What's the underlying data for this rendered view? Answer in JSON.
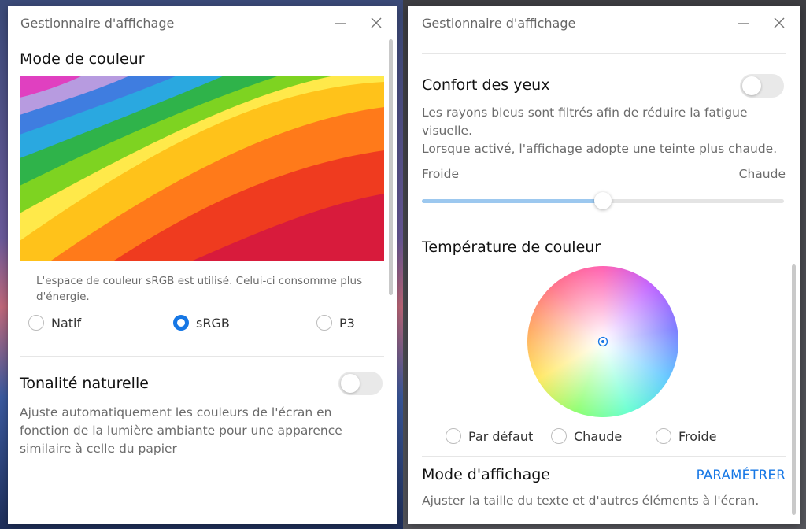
{
  "left_window": {
    "title": "Gestionnaire d'affichage",
    "color_mode": {
      "title": "Mode de couleur",
      "description": "L'espace de couleur sRGB est utilisé. Celui-ci consomme plus d'énergie.",
      "options": [
        "Natif",
        "sRGB",
        "P3"
      ],
      "selected": "sRGB"
    },
    "natural_tone": {
      "title": "Tonalité naturelle",
      "enabled": false,
      "description": "Ajuste automatiquement les couleurs de l'écran en fonction de la lumière ambiante pour une apparence similaire à celle du papier"
    }
  },
  "right_window": {
    "title": "Gestionnaire d'affichage",
    "eye_comfort": {
      "title": "Confort des yeux",
      "enabled": false,
      "description1": "Les rayons bleus sont filtrés afin de réduire la fatigue visuelle.",
      "description2": "Lorsque activé, l'affichage adopte une teinte plus chaude.",
      "slider_min_label": "Froide",
      "slider_max_label": "Chaude",
      "slider_value": 0.5
    },
    "color_temperature": {
      "title": "Température de couleur",
      "options": [
        "Par défaut",
        "Chaude",
        "Froide"
      ],
      "selected": null
    },
    "display_mode": {
      "title": "Mode d'affichage",
      "action": "PARAMÉTRER",
      "description": "Ajuster la taille du texte et d'autres éléments à l'écran."
    }
  },
  "colors": {
    "accent": "#1677e5",
    "slider_fill": "#9cc8ef"
  },
  "icons": {
    "minimize": "minimize-icon",
    "close": "close-icon",
    "wheel_center": "crosshair-icon"
  }
}
